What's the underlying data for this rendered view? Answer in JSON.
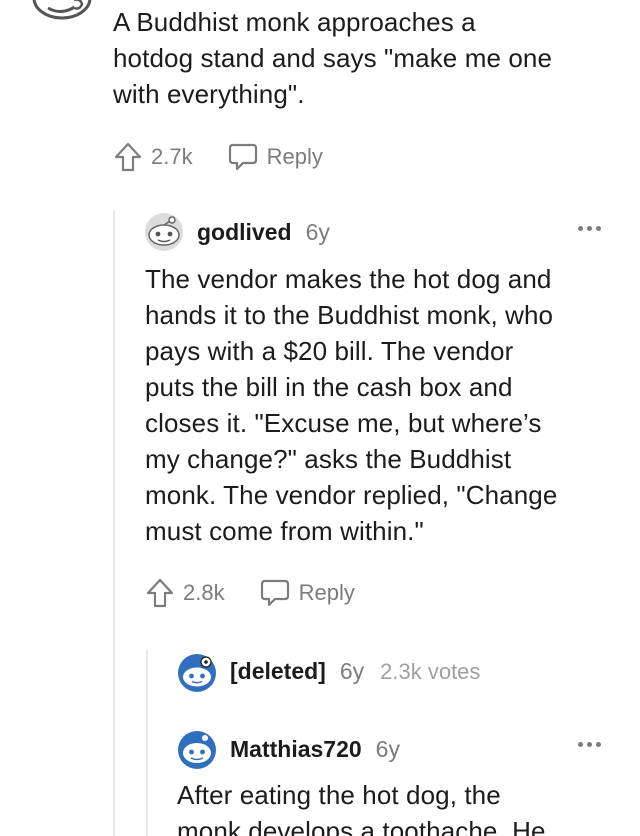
{
  "root_comment": {
    "lines": [
      "A Buddhist monk approaches a",
      "hotdog stand and says \"make me one",
      "with everything\"."
    ],
    "upvotes": "2.7k",
    "reply_label": "Reply"
  },
  "comment_godlived": {
    "username": "godlived",
    "age": "6y",
    "lines": [
      "The vendor makes the hot dog and",
      "hands it to the Buddhist monk, who",
      "pays with a $20 bill. The vendor",
      "puts the bill in the cash box and",
      "closes it. \"Excuse me, but where’s",
      "my change?\" asks the Buddhist",
      "monk. The vendor replied, \"Change",
      "must come from within.\""
    ],
    "upvotes": "2.8k",
    "reply_label": "Reply"
  },
  "comment_deleted": {
    "username": "[deleted]",
    "age": "6y",
    "votes": "2.3k votes"
  },
  "comment_matthias": {
    "username": "Matthias720",
    "age": "6y",
    "lines": [
      "After eating the hot dog, the",
      "monk develops a toothache. He"
    ]
  },
  "icons": {
    "upvote": "upvote-arrow-icon",
    "reply": "speech-bubble-icon",
    "more": "more-options-icon"
  },
  "colors": {
    "text": "#1c1c1c",
    "muted": "#7c7c7c",
    "avatar_blue": "#2f6fbd"
  }
}
